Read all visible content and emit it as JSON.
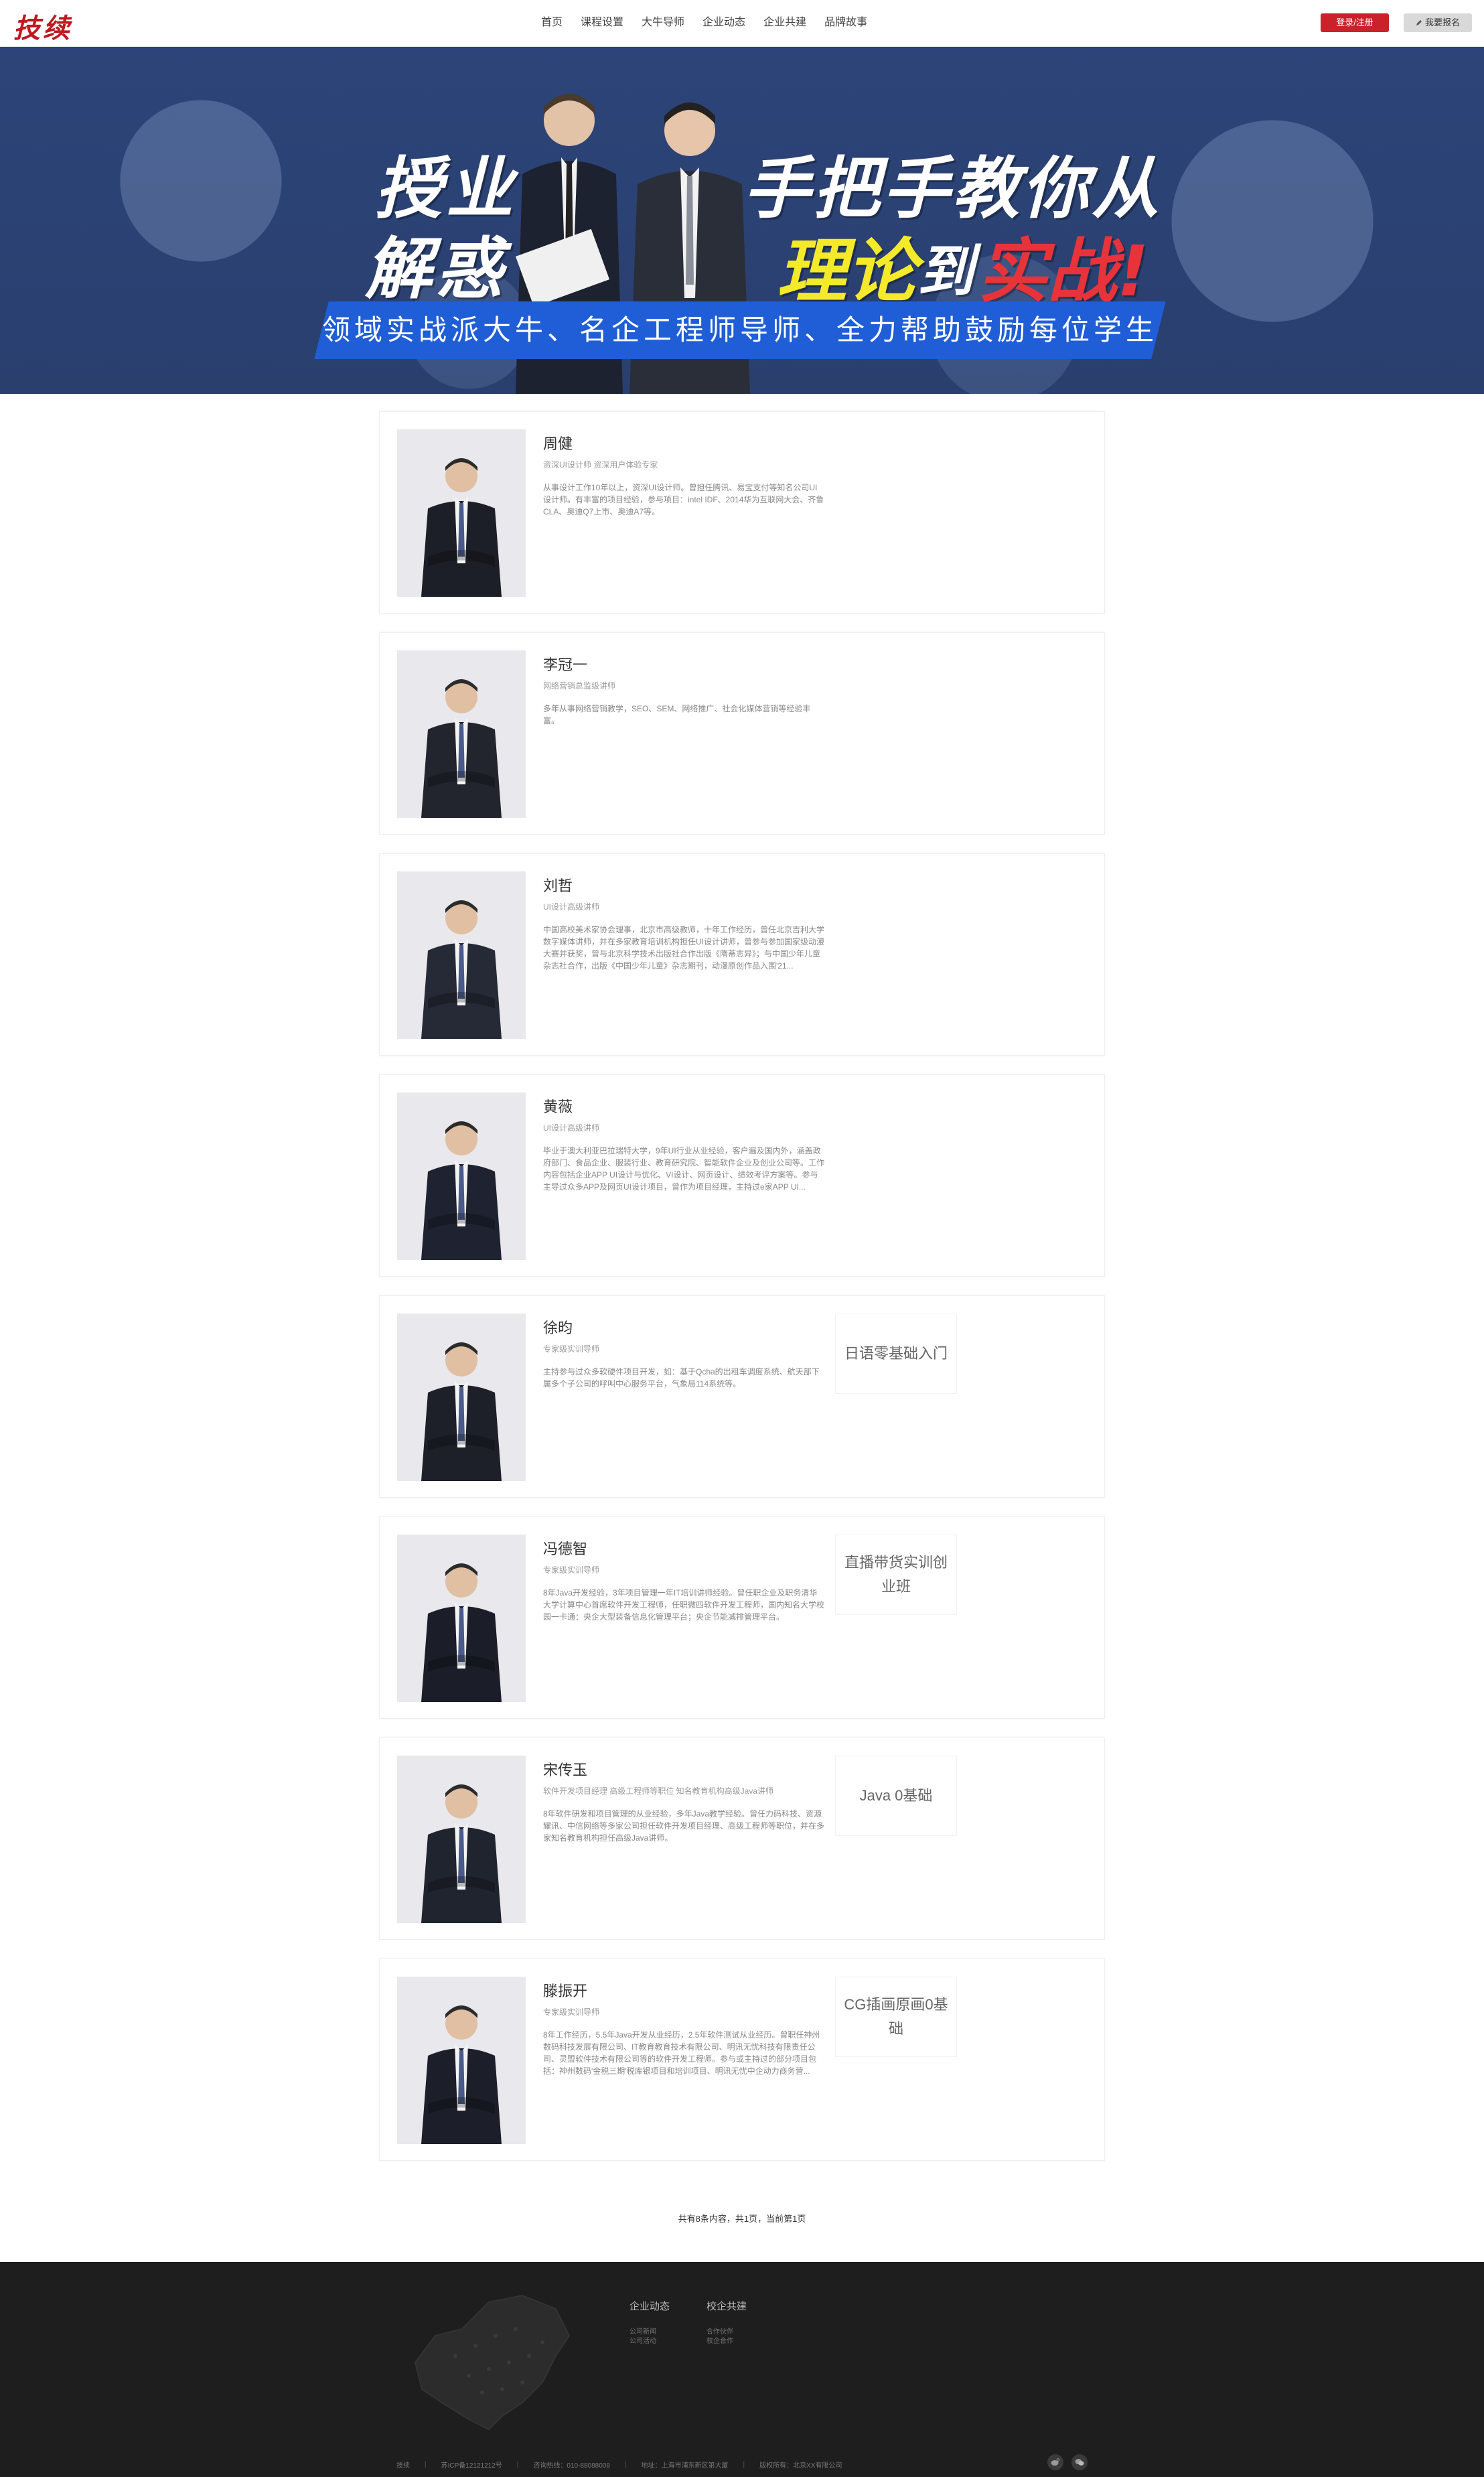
{
  "header": {
    "logo": "技续",
    "nav": [
      "首页",
      "课程设置",
      "大牛导师",
      "企业动态",
      "企业共建",
      "品牌故事"
    ],
    "login_label": "登录/注册",
    "signup_label": "我要报名"
  },
  "banner": {
    "line1": "授业",
    "line2": "解惑",
    "line3": "手把手教你从",
    "line4_a": "理论",
    "line4_b": "到",
    "line4_c": "实战!",
    "slogan": "领域实战派大牛、名企工程师导师、全力帮助鼓励每位学生",
    "colors": {
      "background": "#2c4479",
      "bar": "#1f5ed6",
      "yellow": "#f5ea2a",
      "red": "#e8333a"
    }
  },
  "teachers": [
    {
      "name": "周健",
      "title": "资深UI设计师 资深用户体验专家",
      "desc": "从事设计工作10年以上，资深UI设计师。曾担任腾讯、易宝支付等知名公司UI设计师。有丰富的项目经验，参与项目：intel IDF、2014华为互联网大会、齐鲁CLA、奥迪Q7上市、奥迪A7等。",
      "course": ""
    },
    {
      "name": "李冠一",
      "title": "网络营销总监级讲师",
      "desc": "多年从事网络营销教学，SEO、SEM、网络推广、社会化媒体营销等经验丰富。",
      "course": ""
    },
    {
      "name": "刘哲",
      "title": "UI设计高级讲师",
      "desc": "中国高校美术家协会理事，北京市高级教师，十年工作经历，曾任北京吉利大学数字媒体讲师，并在多家教育培训机构担任UI设计讲师，曾参与参加国家级动漫大赛并获奖，曾与北京科学技术出版社合作出版《隋蒂志异》；与中国少年儿童杂志社合作，出版《中国少年儿童》杂志期刊，动漫原创作品入围'21...",
      "course": ""
    },
    {
      "name": "黄薇",
      "title": "UI设计高级讲师",
      "desc": "毕业于澳大利亚巴拉瑞特大学，9年UI行业从业经验，客户遍及国内外，涵盖政府部门、食品企业、服装行业、教育研究院、智能软件企业及创业公司等。工作内容包括企业APP UI设计与优化、VI设计、网页设计、绩效考评方案等。参与主导过众多APP及网页UI设计项目，曾作为项目经理，主持过e家APP UI...",
      "course": ""
    },
    {
      "name": "徐昀",
      "title": "专家级实训导师",
      "desc": "主持参与过众多软硬件项目开发，如：基于Qcha的出租车调度系统、航天部下属多个子公司的呼叫中心服务平台，气象局114系统等。",
      "course": "日语零基础入门"
    },
    {
      "name": "冯德智",
      "title": "专家级实训导师",
      "desc": "8年Java开发经验，3年项目管理一年IT培训讲师经验。曾任职企业及职务清华大学计算中心首席软件开发工程师，任职微四软件开发工程师，国内知名大学校园一卡通：央企大型装备信息化管理平台；央企节能减排管理平台。",
      "course": "直播带货实训创业班"
    },
    {
      "name": "宋传玉",
      "title": "软件开发项目经理 高级工程师等职位 知名教育机构高级Java讲师",
      "desc": "8年软件研发和项目管理的从业经验，多年Java教学经验。曾任力码科技、资源耀讯、中信网络等多家公司担任软件开发项目经理、高级工程师等职位，并在多家知名教育机构担任高级Java讲师。",
      "course": "Java 0基础"
    },
    {
      "name": "滕振开",
      "title": "专家级实训导师",
      "desc": "8年工作经历，5.5年Java开发从业经历，2.5年软件测试从业经历。曾职任神州数码科技发展有限公司、IT教育教育技术有限公司、明讯无忧科技有限责任公司、灵盟软件技术有限公司等的软件开发工程师。参与或主持过的部分项目包括：神州数码'金税三期'税库银项目和培训项目、明讯无忧中企动力商务营...",
      "course": "CG插画原画0基础"
    }
  ],
  "pagination": "共有8条内容，共1页，当前第1页",
  "footer": {
    "col1_title": "企业动态",
    "col1_links": [
      "公司新闻",
      "公司活动"
    ],
    "col2_title": "校企共建",
    "col2_links": [
      "合作伙伴",
      "校企合作"
    ],
    "bottom": [
      "技续",
      "苏ICP备12121212号",
      "咨询热线：010-88088008",
      "地址：上海市浦东新区第大厦",
      "版权所有：北京XX有限公司"
    ]
  }
}
